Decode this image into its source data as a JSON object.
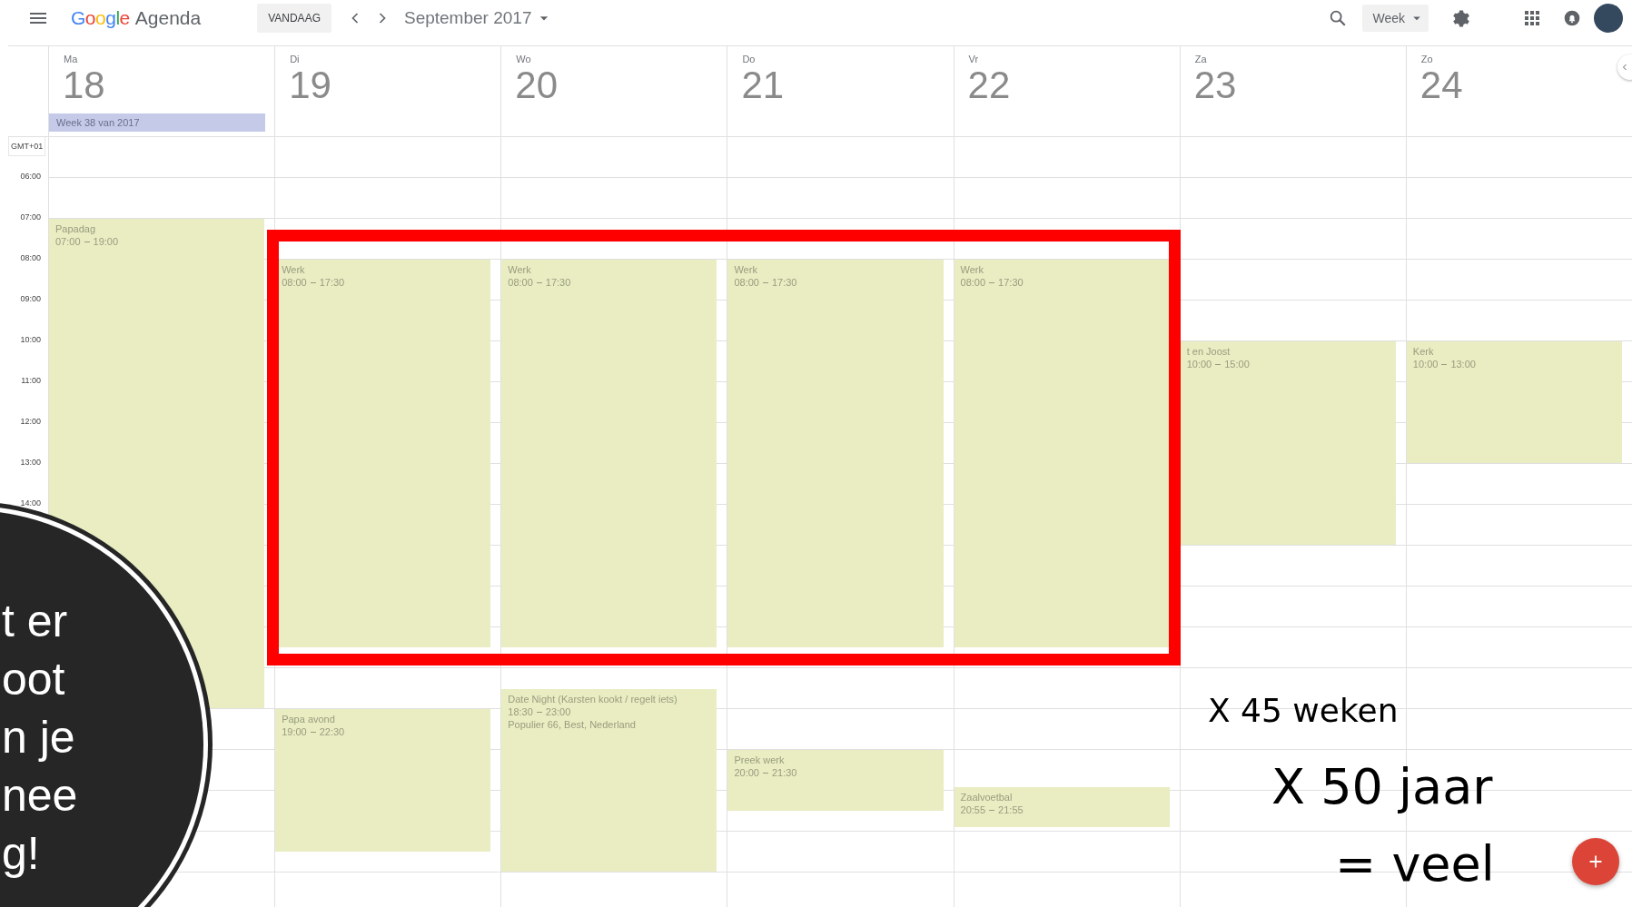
{
  "header": {
    "logo": "Google",
    "title": "Agenda",
    "today_button": "VANDAAG",
    "period": "September 2017",
    "view": "Week"
  },
  "timezone": "GMT+01",
  "hours": [
    "06:00",
    "07:00",
    "08:00",
    "09:00",
    "10:00",
    "11:00",
    "12:00",
    "13:00",
    "14:00"
  ],
  "days": [
    {
      "name": "Ma",
      "date": "18",
      "banner": "Week 38 van 2017",
      "events": [
        {
          "title": "Papadag",
          "start": "07:00",
          "end": "19:00"
        }
      ]
    },
    {
      "name": "Di",
      "date": "19",
      "events": [
        {
          "title": "Werk",
          "start": "08:00",
          "end": "17:30"
        },
        {
          "title": "Papa avond",
          "start": "19:00",
          "end": "22:30"
        }
      ]
    },
    {
      "name": "Wo",
      "date": "20",
      "events": [
        {
          "title": "Werk",
          "start": "08:00",
          "end": "17:30"
        },
        {
          "title": "Date Night (Karsten kookt / regelt iets)",
          "location": "Populier 66, Best, Nederland",
          "start": "18:30",
          "end": "23:00"
        }
      ]
    },
    {
      "name": "Do",
      "date": "21",
      "events": [
        {
          "title": "Werk",
          "start": "08:00",
          "end": "17:30"
        },
        {
          "title": "Preek werk",
          "start": "20:00",
          "end": "21:30"
        }
      ]
    },
    {
      "name": "Vr",
      "date": "22",
      "events": [
        {
          "title": "Werk",
          "start": "08:00",
          "end": "17:30"
        },
        {
          "title": "Zaalvoetbal",
          "start": "20:55",
          "end": "21:55"
        }
      ]
    },
    {
      "name": "Za",
      "date": "23",
      "events": [
        {
          "title": "t en Joost",
          "start": "10:00",
          "end": "15:00"
        }
      ]
    },
    {
      "name": "Zo",
      "date": "24",
      "events": [
        {
          "title": "Kerk",
          "start": "10:00",
          "end": "13:00"
        }
      ]
    }
  ],
  "overlay": {
    "circle_lines": [
      "t er",
      "oot",
      "n je",
      "nee",
      "g!"
    ],
    "notes": [
      {
        "kind": "medium",
        "text": "X 45 weken"
      },
      {
        "kind": "large",
        "text": "X 50 jaar"
      },
      {
        "kind": "large",
        "text": "= veel"
      }
    ]
  }
}
